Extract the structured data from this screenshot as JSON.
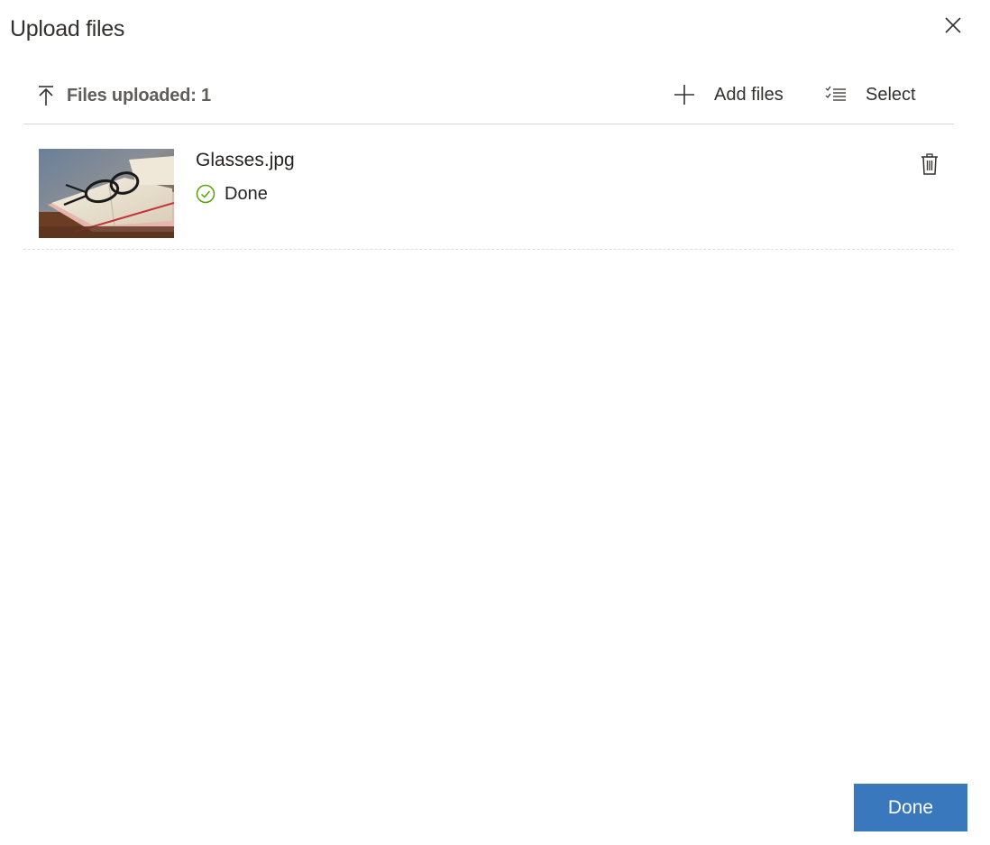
{
  "dialog": {
    "title": "Upload files",
    "close_icon": "close-icon"
  },
  "toolbar": {
    "uploaded_icon": "upload-arrow-icon",
    "uploaded_label": "Files uploaded: 1",
    "add_files_icon": "plus-icon",
    "add_files_label": "Add files",
    "select_icon": "checklist-icon",
    "select_label": "Select"
  },
  "files": [
    {
      "name": "Glasses.jpg",
      "status": "Done",
      "status_icon": "check-circle-icon",
      "status_color": "#57a300",
      "thumbnail": "glasses-on-open-book-thumbnail",
      "delete_icon": "trash-icon"
    }
  ],
  "footer": {
    "done_label": "Done",
    "accent_color": "#3a78be"
  }
}
